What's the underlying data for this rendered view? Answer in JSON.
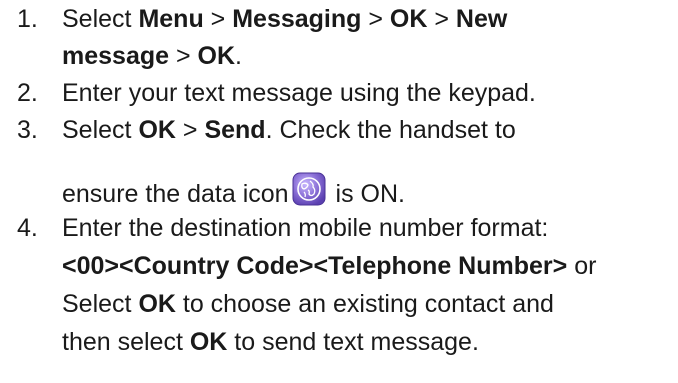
{
  "steps": [
    {
      "number": "1.",
      "lines": [
        [
          "Select ",
          "Menu",
          " > ",
          "Messaging",
          " > ",
          "OK",
          " > ",
          "New"
        ],
        [
          "message",
          " > ",
          "OK",
          "."
        ]
      ]
    },
    {
      "number": "2.",
      "lines": [
        [
          "Enter your text message using the keypad."
        ]
      ]
    },
    {
      "number": "3.",
      "lines": [
        [
          "Select ",
          "OK",
          " > ",
          "Send",
          ".  Check the handset to"
        ],
        [
          "ensure the data icon",
          " is ON."
        ]
      ]
    },
    {
      "number": "4.",
      "lines": [
        [
          "Enter the destination mobile number format:"
        ],
        [
          "<00><Country Code><Telephone Number>",
          " or"
        ],
        [
          "Select ",
          "OK",
          " to choose an existing contact and"
        ],
        [
          "then select ",
          "OK",
          " to send text message."
        ]
      ]
    }
  ],
  "icons": {
    "data_icon": "data-globe-icon",
    "data_icon_color": "#8a6fd6"
  }
}
